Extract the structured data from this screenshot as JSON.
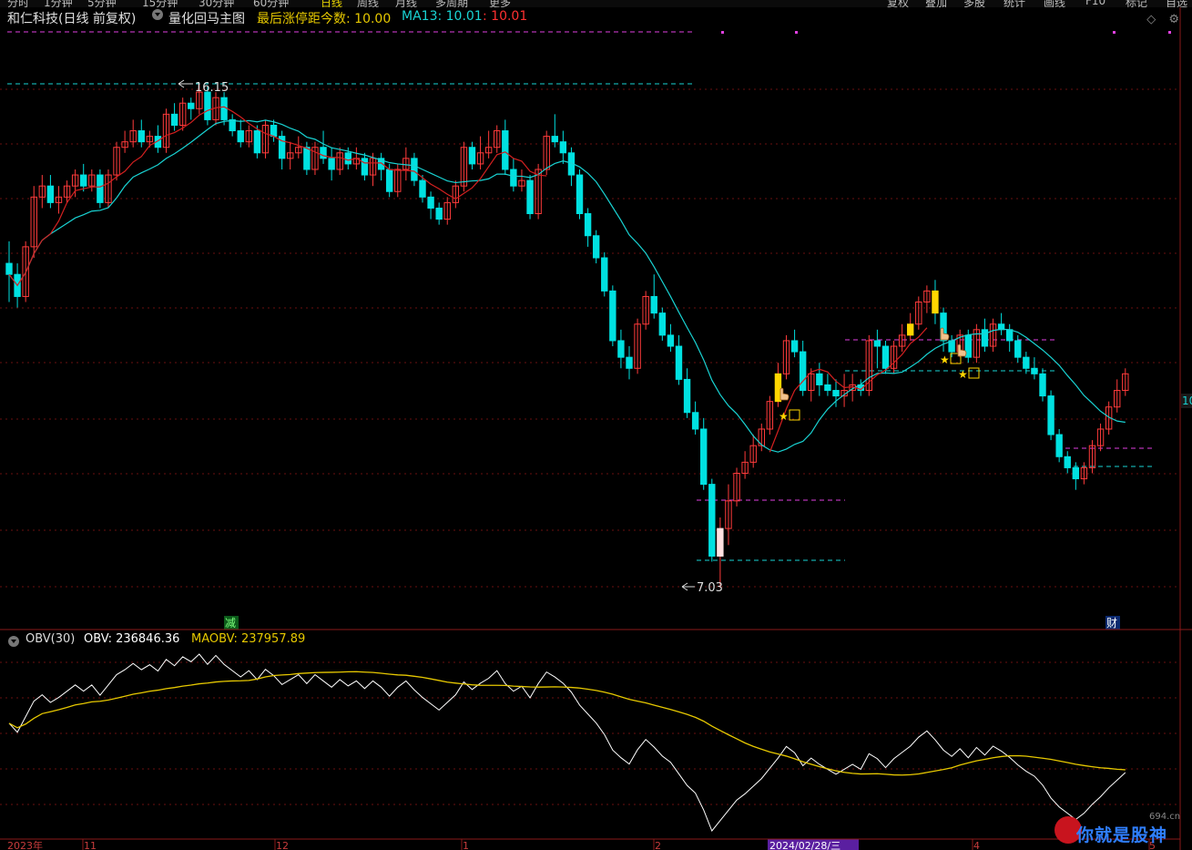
{
  "topbar": {
    "tabs": [
      "分时",
      "1分钟",
      "5分钟",
      "15分钟",
      "30分钟",
      "60分钟",
      "日线",
      "周线",
      "月线",
      "多周期",
      "更多"
    ],
    "active_tab": "日线",
    "buttons": [
      "复权",
      "叠加",
      "多股",
      "统计",
      "画线",
      "F10",
      "标记",
      "自选"
    ]
  },
  "header": {
    "stock": "和仁科技(日线 前复权)",
    "indicator_name": "量化回马主图",
    "last_limit_label": "最后涨停距今数: 10.00",
    "ma13_label": "MA13: 10.01",
    "extra_value": ": 10.01",
    "colors": {
      "stock": "#e0e0e0",
      "indicator": "#e0e0e0",
      "last_limit": "#e6c800",
      "ma13": "#19d3d3",
      "extra": "#ff3030"
    }
  },
  "obv_header": {
    "name": "OBV(30)",
    "obv_label": "OBV: 236846.36",
    "maobv_label": "MAOBV: 237957.89",
    "colors": {
      "name": "#dddddd",
      "obv": "#ffffff",
      "maobv": "#e6c800"
    }
  },
  "markers": {
    "high_label": "16.15",
    "low_label": "7.03",
    "event_reduce": "减",
    "event_finance": "财",
    "right_price_tag": "10"
  },
  "x_axis": {
    "labels": [
      "2023年",
      "11",
      "12",
      "1",
      "2",
      "2024/02/28/三",
      "4",
      "5"
    ]
  },
  "colors": {
    "up": "#ff3b3b",
    "down": "#00e1e1",
    "ma13": "#19d3d3",
    "red_line": "#d42020",
    "obv": "#ffffff",
    "maobv": "#e6c800",
    "magenta": "#e040e0",
    "cyan_dash": "#19d3d3",
    "grid": "#6a1010",
    "signal": "#ffd600",
    "icons": {
      "high_arrow": "left-arrow-icon",
      "low_arrow": "left-arrow-icon",
      "star": "star-icon",
      "hand": "hand-pointer-icon"
    }
  },
  "chart_data": {
    "type": "candlestick",
    "series": [
      {
        "name": "MA13"
      },
      {
        "name": "OBV"
      },
      {
        "name": "MAOBV"
      }
    ],
    "high": 16.15,
    "low": 7.03,
    "last_limit_days": 10.0,
    "ma13_last": 10.01,
    "obv_last": 236846.36,
    "maobv_last": 237957.89,
    "candles": [
      [
        12.9,
        12.7,
        13.3,
        12.2
      ],
      [
        12.7,
        12.3,
        12.9,
        12.1
      ],
      [
        12.3,
        13.2,
        13.3,
        12.2
      ],
      [
        13.2,
        14.1,
        14.3,
        13.0
      ],
      [
        14.1,
        14.3,
        14.5,
        13.9
      ],
      [
        14.3,
        14.0,
        14.5,
        13.9
      ],
      [
        14.0,
        14.1,
        14.3,
        13.8
      ],
      [
        14.1,
        14.3,
        14.4,
        14.0
      ],
      [
        14.3,
        14.5,
        14.6,
        14.1
      ],
      [
        14.5,
        14.3,
        14.7,
        14.2
      ],
      [
        14.3,
        14.5,
        14.6,
        14.2
      ],
      [
        14.5,
        14.0,
        14.6,
        13.9
      ],
      [
        14.0,
        14.5,
        14.6,
        13.9
      ],
      [
        14.5,
        15.0,
        15.1,
        14.4
      ],
      [
        15.0,
        15.1,
        15.3,
        14.9
      ],
      [
        15.1,
        15.3,
        15.5,
        15.0
      ],
      [
        15.3,
        15.1,
        15.5,
        15.0
      ],
      [
        15.1,
        15.2,
        15.3,
        15.0
      ],
      [
        15.2,
        15.0,
        15.4,
        14.9
      ],
      [
        15.0,
        15.6,
        15.7,
        14.9
      ],
      [
        15.6,
        15.4,
        15.8,
        15.3
      ],
      [
        15.4,
        15.8,
        15.9,
        15.3
      ],
      [
        15.8,
        15.7,
        15.9,
        15.5
      ],
      [
        15.7,
        16.0,
        16.15,
        15.6
      ],
      [
        16.0,
        15.5,
        16.1,
        15.4
      ],
      [
        15.5,
        15.9,
        16.0,
        15.4
      ],
      [
        15.9,
        15.5,
        16.0,
        15.4
      ],
      [
        15.5,
        15.3,
        15.6,
        15.2
      ],
      [
        15.3,
        15.1,
        15.5,
        15.0
      ],
      [
        15.1,
        15.3,
        15.4,
        15.0
      ],
      [
        15.3,
        14.9,
        15.4,
        14.8
      ],
      [
        14.9,
        15.4,
        15.5,
        14.8
      ],
      [
        15.4,
        15.2,
        15.5,
        15.1
      ],
      [
        15.2,
        14.8,
        15.3,
        14.6
      ],
      [
        14.8,
        14.9,
        15.1,
        14.6
      ],
      [
        14.9,
        15.0,
        15.2,
        14.8
      ],
      [
        15.0,
        14.6,
        15.1,
        14.5
      ],
      [
        14.6,
        15.0,
        15.1,
        14.5
      ],
      [
        15.0,
        14.8,
        15.3,
        14.7
      ],
      [
        14.8,
        14.6,
        15.0,
        14.4
      ],
      [
        14.6,
        14.9,
        15.0,
        14.5
      ],
      [
        14.9,
        14.7,
        15.0,
        14.6
      ],
      [
        14.7,
        14.8,
        15.0,
        14.6
      ],
      [
        14.8,
        14.5,
        14.9,
        14.4
      ],
      [
        14.5,
        14.8,
        14.9,
        14.3
      ],
      [
        14.8,
        14.6,
        14.9,
        14.4
      ],
      [
        14.6,
        14.2,
        14.7,
        14.1
      ],
      [
        14.2,
        14.6,
        14.7,
        14.1
      ],
      [
        14.6,
        14.8,
        15.0,
        14.4
      ],
      [
        14.8,
        14.4,
        14.9,
        14.3
      ],
      [
        14.4,
        14.1,
        14.5,
        14.0
      ],
      [
        14.1,
        13.9,
        14.2,
        13.7
      ],
      [
        13.9,
        13.7,
        14.0,
        13.6
      ],
      [
        13.7,
        14.0,
        14.1,
        13.6
      ],
      [
        14.0,
        14.3,
        14.4,
        13.9
      ],
      [
        14.3,
        15.0,
        15.1,
        14.2
      ],
      [
        15.0,
        14.7,
        15.1,
        14.6
      ],
      [
        14.7,
        14.9,
        15.2,
        14.6
      ],
      [
        14.9,
        15.0,
        15.3,
        14.8
      ],
      [
        15.0,
        15.3,
        15.4,
        14.9
      ],
      [
        15.3,
        14.6,
        15.5,
        14.5
      ],
      [
        14.6,
        14.3,
        14.8,
        14.2
      ],
      [
        14.3,
        14.4,
        14.6,
        14.2
      ],
      [
        14.4,
        13.8,
        14.5,
        13.7
      ],
      [
        13.8,
        14.6,
        14.7,
        13.7
      ],
      [
        14.6,
        15.2,
        15.3,
        14.5
      ],
      [
        15.2,
        15.1,
        15.6,
        15.0
      ],
      [
        15.1,
        14.9,
        15.3,
        14.7
      ],
      [
        14.9,
        14.5,
        15.0,
        14.3
      ],
      [
        14.5,
        13.8,
        14.6,
        13.7
      ],
      [
        13.8,
        13.4,
        13.9,
        13.2
      ],
      [
        13.4,
        13.0,
        13.5,
        12.9
      ],
      [
        13.0,
        12.4,
        13.1,
        12.3
      ],
      [
        12.4,
        11.5,
        12.5,
        11.4
      ],
      [
        11.5,
        11.2,
        11.7,
        11.0
      ],
      [
        11.2,
        11.0,
        11.4,
        10.8
      ],
      [
        11.0,
        11.8,
        11.9,
        10.9
      ],
      [
        11.8,
        12.3,
        12.4,
        11.7
      ],
      [
        12.3,
        12.0,
        12.7,
        11.9
      ],
      [
        12.0,
        11.6,
        12.1,
        11.5
      ],
      [
        11.6,
        11.4,
        11.8,
        11.3
      ],
      [
        11.4,
        10.8,
        11.6,
        10.7
      ],
      [
        10.8,
        10.2,
        11.0,
        10.1
      ],
      [
        10.2,
        9.9,
        10.4,
        9.8
      ],
      [
        9.9,
        8.9,
        10.1,
        8.8
      ],
      [
        8.9,
        7.6,
        9.0,
        7.5
      ],
      [
        7.6,
        8.1,
        8.3,
        7.03
      ],
      [
        8.1,
        8.6,
        8.9,
        7.8
      ],
      [
        8.6,
        9.1,
        9.2,
        8.5
      ],
      [
        9.1,
        9.3,
        9.5,
        9.0
      ],
      [
        9.3,
        9.6,
        9.8,
        9.2
      ],
      [
        9.6,
        9.9,
        10.0,
        9.5
      ],
      [
        9.9,
        10.4,
        10.5,
        9.8
      ],
      [
        10.4,
        10.9,
        11.1,
        10.3
      ],
      [
        10.9,
        11.5,
        11.6,
        10.8
      ],
      [
        11.5,
        11.3,
        11.7,
        11.2
      ],
      [
        11.3,
        10.6,
        11.5,
        10.5
      ],
      [
        10.6,
        10.9,
        11.0,
        10.4
      ],
      [
        10.9,
        10.7,
        11.1,
        10.5
      ],
      [
        10.7,
        10.6,
        10.9,
        10.5
      ],
      [
        10.6,
        10.5,
        10.8,
        10.3
      ],
      [
        10.5,
        10.6,
        10.9,
        10.3
      ],
      [
        10.6,
        10.7,
        10.9,
        10.4
      ],
      [
        10.7,
        10.6,
        10.8,
        10.5
      ],
      [
        10.6,
        11.5,
        11.6,
        10.5
      ],
      [
        11.5,
        11.4,
        11.7,
        11.0
      ],
      [
        11.4,
        11.0,
        11.5,
        10.9
      ],
      [
        11.0,
        11.4,
        11.5,
        10.9
      ],
      [
        11.4,
        11.6,
        11.8,
        11.3
      ],
      [
        11.6,
        11.8,
        12.0,
        11.5
      ],
      [
        11.8,
        12.2,
        12.3,
        11.7
      ],
      [
        12.2,
        12.4,
        12.5,
        12.0
      ],
      [
        12.4,
        12.0,
        12.6,
        11.8
      ],
      [
        12.0,
        11.5,
        12.1,
        11.3
      ],
      [
        11.5,
        11.3,
        11.6,
        11.2
      ],
      [
        11.3,
        11.6,
        11.7,
        11.2
      ],
      [
        11.6,
        11.2,
        11.7,
        11.1
      ],
      [
        11.2,
        11.7,
        11.8,
        11.1
      ],
      [
        11.7,
        11.4,
        11.9,
        11.3
      ],
      [
        11.4,
        11.8,
        11.9,
        11.3
      ],
      [
        11.8,
        11.7,
        12.0,
        11.6
      ],
      [
        11.7,
        11.5,
        11.8,
        11.3
      ],
      [
        11.5,
        11.2,
        11.6,
        11.1
      ],
      [
        11.2,
        11.0,
        11.3,
        10.9
      ],
      [
        11.0,
        10.9,
        11.2,
        10.8
      ],
      [
        10.9,
        10.5,
        11.0,
        10.4
      ],
      [
        10.5,
        9.8,
        10.6,
        9.7
      ],
      [
        9.8,
        9.4,
        9.9,
        9.3
      ],
      [
        9.4,
        9.2,
        9.5,
        9.1
      ],
      [
        9.2,
        9.0,
        9.3,
        8.8
      ],
      [
        9.0,
        9.2,
        9.3,
        8.9
      ],
      [
        9.2,
        9.6,
        9.7,
        9.1
      ],
      [
        9.6,
        9.9,
        10.0,
        9.5
      ],
      [
        9.9,
        10.3,
        10.4,
        9.8
      ],
      [
        10.3,
        10.6,
        10.8,
        10.2
      ],
      [
        10.6,
        10.9,
        11.0,
        10.5
      ]
    ]
  }
}
